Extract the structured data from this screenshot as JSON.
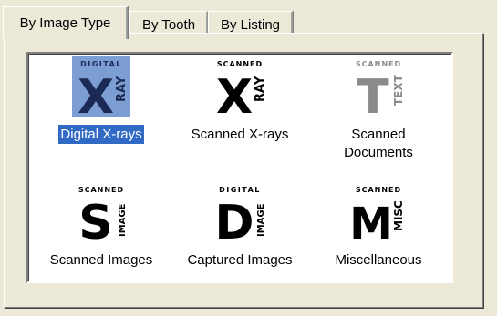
{
  "tabs": [
    {
      "label": "By Image Type",
      "active": true
    },
    {
      "label": "By Tooth",
      "active": false
    },
    {
      "label": "By Listing",
      "active": false
    }
  ],
  "items": [
    {
      "label": "Digital X-rays",
      "icon": "digital-xray-icon",
      "top_word": "DIGITAL",
      "letter": "X",
      "side_word": "RAY",
      "selected": true
    },
    {
      "label": "Scanned X-rays",
      "icon": "scanned-xray-icon",
      "top_word": "SCANNED",
      "letter": "X",
      "side_word": "RAY",
      "selected": false
    },
    {
      "label": "Scanned Documents",
      "label_line1": "Scanned",
      "label_line2": "Documents",
      "icon": "scanned-text-icon",
      "top_word": "SCANNED",
      "letter": "T",
      "side_word": "TEXT",
      "selected": false
    },
    {
      "label": "Scanned Images",
      "icon": "scanned-image-icon",
      "top_word": "SCANNED",
      "letter": "S",
      "side_word": "IMAGE",
      "selected": false
    },
    {
      "label": "Captured Images",
      "icon": "digital-image-icon",
      "top_word": "DIGITAL",
      "letter": "D",
      "side_word": "IMAGE",
      "selected": false
    },
    {
      "label": "Miscellaneous",
      "icon": "scanned-misc-icon",
      "top_word": "SCANNED",
      "letter": "M",
      "side_word": "MISC",
      "selected": false
    }
  ],
  "colors": {
    "selection": "#316ac5",
    "icon_highlight": "#7d9ed3",
    "dialog_bg": "#ece9d8"
  }
}
